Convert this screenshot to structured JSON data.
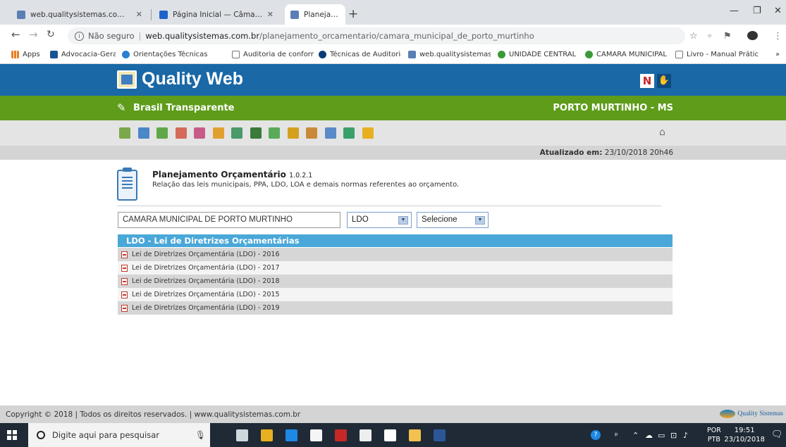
{
  "browser": {
    "tabs": [
      {
        "label": "web.qualitysistemas.com.br/adm",
        "favicon_color": "#5a7fb5",
        "active": false
      },
      {
        "label": "Página Inicial — Câmara Municip",
        "favicon_color": "#1e64c8",
        "active": false
      },
      {
        "label": "Planejamento Orçamentário",
        "favicon_color": "#5a7fb5",
        "active": true
      }
    ],
    "new_tab": "+",
    "window_controls": [
      "—",
      "❐",
      "✕"
    ],
    "url": {
      "security": "Não seguro",
      "host": "web.qualitysistemas.com.br",
      "path": "/planejamento_orcamentario/camara_municipal_de_porto_murtinho"
    },
    "bookmarks": [
      {
        "label": "Apps",
        "color": "#e67e22"
      },
      {
        "label": "Advocacia-Geral da U",
        "color": "#1a5490"
      },
      {
        "label": "Orientações Técnicas",
        "color": "#2a7fd4"
      },
      {
        "label": "Auditoria de conform",
        "color": "#777777"
      },
      {
        "label": "Técnicas de Auditoria",
        "color": "#0c3c78"
      },
      {
        "label": "web.qualitysistemas.c",
        "color": "#5a7fb5"
      },
      {
        "label": "UNIDADE CENTRAL D",
        "color": "#3a9a3a"
      },
      {
        "label": "CÂMARA MUNICIPAL",
        "color": "#3a9a3a"
      },
      {
        "label": "Livro - Manual Prátic",
        "color": "#777777"
      }
    ],
    "bookmarks_overflow": "»"
  },
  "header": {
    "logo_text": "Quality Web",
    "accessibility_n": "N",
    "accessibility_hand": "✋"
  },
  "portal": {
    "name": "Brasil Transparente",
    "city": "PORTO MURTINHO - MS"
  },
  "toolbar_icons": [
    {
      "name": "chart-area-icon",
      "color": "#7aa84a"
    },
    {
      "name": "clipboard-icon",
      "color": "#4a86c8"
    },
    {
      "name": "money-in-icon",
      "color": "#5fa84a"
    },
    {
      "name": "money-out-icon",
      "color": "#d46a5a"
    },
    {
      "name": "document-person-icon",
      "color": "#c85a8a"
    },
    {
      "name": "tools-icon",
      "color": "#e0a030"
    },
    {
      "name": "calculator-icon",
      "color": "#4a9a6a"
    },
    {
      "name": "pen-icon",
      "color": "#3a7a3a"
    },
    {
      "name": "pen-green-icon",
      "color": "#5aaa5a"
    },
    {
      "name": "bar-chart-icon",
      "color": "#d4a020"
    },
    {
      "name": "people-list-icon",
      "color": "#c88a3a"
    },
    {
      "name": "vehicle-doc-icon",
      "color": "#5a8ac8"
    },
    {
      "name": "list-doc-icon",
      "color": "#3aa06a"
    },
    {
      "name": "info-icon",
      "color": "#e8b020"
    }
  ],
  "home_icon": "⌂",
  "updated": {
    "label": "Atualizado em:",
    "value": "23/10/2018 20h46"
  },
  "module": {
    "title": "Planejamento Orçamentário",
    "version": "1.0.2.1",
    "subtitle": "Relação das leis municipais, PPA, LDO, LOA e demais normas referentes ao orçamento."
  },
  "filters": {
    "entity": "CAMARA MUNICIPAL DE PORTO MURTINHO",
    "type": "LDO",
    "year": "Selecione",
    "arrow": "▼"
  },
  "ldo": {
    "header": "LDO - Lei de Diretrizes Orçamentárias",
    "items": [
      "Lei de Diretrizes Orçamentária (LDO) - 2016",
      "Lei de Diretrizes Orçamentária (LDO) - 2017",
      "Lei de Diretrizes Orçamentária (LDO) - 2018",
      "Lei de Diretrizes Orçamentária (LDO) - 2015",
      "Lei de Diretrizes Orçamentária (LDO) - 2019"
    ]
  },
  "footer": {
    "copyright": "Copyright © 2018 | Todos os direitos reservados. | www.qualitysistemas.com.br",
    "brand": "Quality Sistemas"
  },
  "taskbar": {
    "search_placeholder": "Digite aqui para pesquisar",
    "lang_top": "POR",
    "lang_bottom": "PTB",
    "time": "19:51",
    "date": "23/10/2018",
    "apps": [
      {
        "name": "task-view-icon",
        "color": "#cfd8dc"
      },
      {
        "name": "chrome-icon",
        "color": "#e8b020"
      },
      {
        "name": "edge-icon",
        "color": "#1e88e5"
      },
      {
        "name": "store-icon",
        "color": "#f5f5f5"
      },
      {
        "name": "netflix-icon",
        "color": "#c62828"
      },
      {
        "name": "mail-icon",
        "color": "#eeeeee"
      },
      {
        "name": "dropbox-icon",
        "color": "#ffffff"
      },
      {
        "name": "file-explorer-icon",
        "color": "#f2c14e"
      },
      {
        "name": "word-icon",
        "color": "#2b5797"
      }
    ]
  }
}
